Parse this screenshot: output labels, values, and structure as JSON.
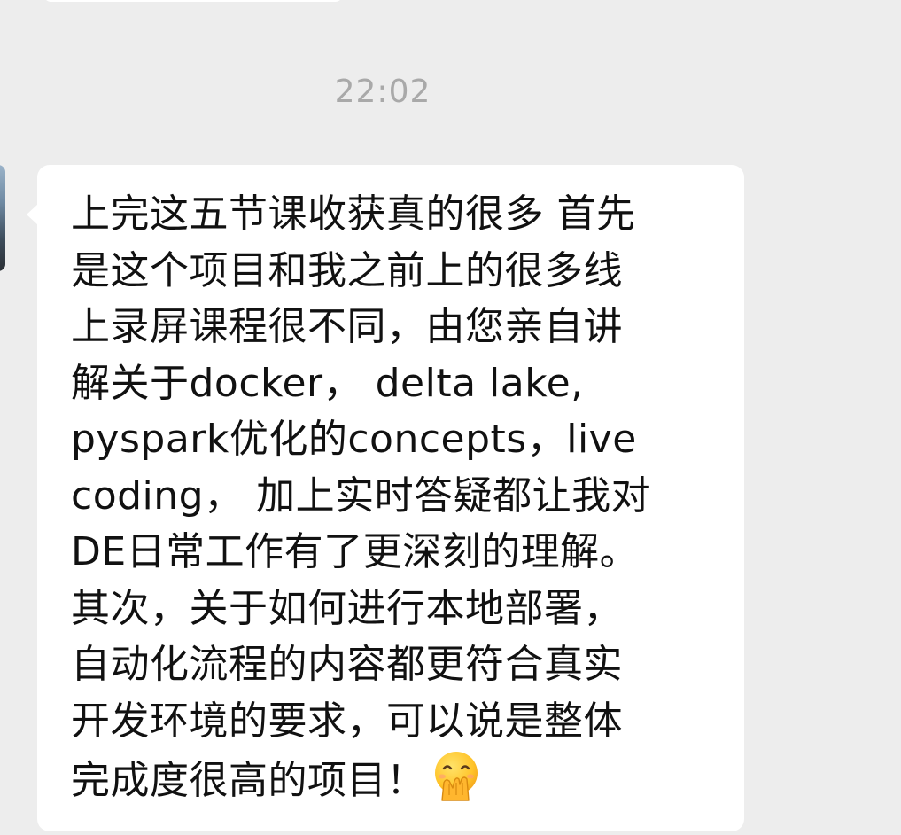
{
  "chat": {
    "timestamp": "22:02",
    "message": {
      "text": "上完这五节课收获真的很多 首先\n是这个项目和我之前上的很多线\n上录屏课程很不同，由您亲自讲\n解关于docker， delta lake,\npyspark优化的concepts，live\ncoding， 加上实时答疑都让我对\nDE日常工作有了更深刻的理解。\n其次，关于如何进行本地部署，\n自动化流程的内容都更符合真实\n开发环境的要求，可以说是整体\n完成度很高的项目！",
      "emoji": "hugging-face-with-hand-over-mouth-emoji"
    },
    "bubble_color": "#ffffff",
    "background_color": "#ededed"
  }
}
